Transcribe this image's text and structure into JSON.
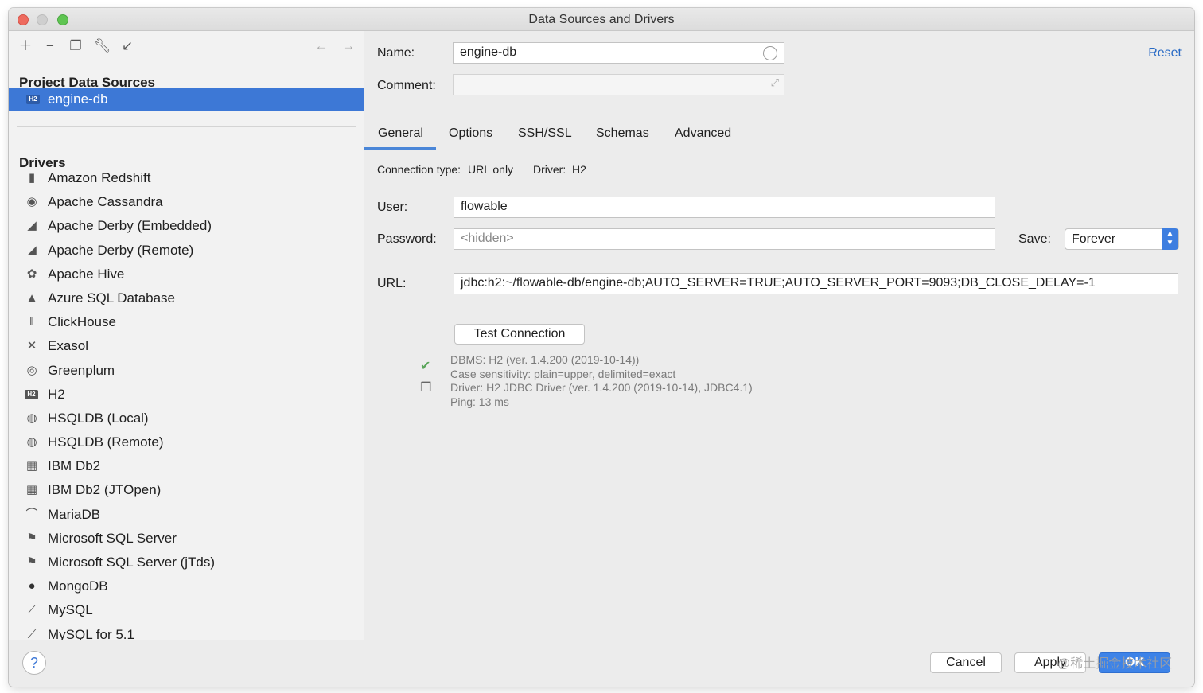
{
  "window": {
    "title": "Data Sources and Drivers"
  },
  "toolbar": {
    "icons": [
      "add-icon",
      "remove-icon",
      "duplicate-icon",
      "wrench-icon",
      "import-icon",
      "back-arrow-icon",
      "forward-arrow-icon"
    ]
  },
  "sidebar": {
    "project_title": "Project Data Sources",
    "selected": {
      "badge": "H2",
      "label": "engine-db"
    },
    "drivers_title": "Drivers",
    "drivers": [
      {
        "label": "Amazon Redshift",
        "icon": "redshift-icon"
      },
      {
        "label": "Apache Cassandra",
        "icon": "cassandra-icon"
      },
      {
        "label": "Apache Derby (Embedded)",
        "icon": "derby-icon"
      },
      {
        "label": "Apache Derby (Remote)",
        "icon": "derby-icon"
      },
      {
        "label": "Apache Hive",
        "icon": "hive-icon"
      },
      {
        "label": "Azure SQL Database",
        "icon": "azure-icon"
      },
      {
        "label": "ClickHouse",
        "icon": "clickhouse-icon"
      },
      {
        "label": "Exasol",
        "icon": "exasol-icon"
      },
      {
        "label": "Greenplum",
        "icon": "greenplum-icon"
      },
      {
        "label": "H2",
        "icon": "h2-icon"
      },
      {
        "label": "HSQLDB (Local)",
        "icon": "hsqldb-icon"
      },
      {
        "label": "HSQLDB (Remote)",
        "icon": "hsqldb-icon"
      },
      {
        "label": "IBM Db2",
        "icon": "db2-icon"
      },
      {
        "label": "IBM Db2 (JTOpen)",
        "icon": "db2-icon"
      },
      {
        "label": "MariaDB",
        "icon": "mariadb-icon"
      },
      {
        "label": "Microsoft SQL Server",
        "icon": "mssql-icon"
      },
      {
        "label": "Microsoft SQL Server (jTds)",
        "icon": "mssql-icon"
      },
      {
        "label": "MongoDB",
        "icon": "mongodb-icon"
      },
      {
        "label": "MySQL",
        "icon": "mysql-icon"
      },
      {
        "label": "MySQL for 5.1",
        "icon": "mysql-icon"
      }
    ]
  },
  "form": {
    "name_label": "Name:",
    "name_value": "engine-db",
    "comment_label": "Comment:",
    "comment_value": "",
    "reset_label": "Reset",
    "tabs": [
      "General",
      "Options",
      "SSH/SSL",
      "Schemas",
      "Advanced"
    ],
    "active_tab": "General",
    "connection_type_label": "Connection type:",
    "connection_type_value": "URL only",
    "driver_label": "Driver:",
    "driver_value": "H2",
    "user_label": "User:",
    "user_value": "flowable",
    "password_label": "Password:",
    "password_placeholder": "<hidden>",
    "save_label": "Save:",
    "save_value": "Forever",
    "url_label": "URL:",
    "url_value": "jdbc:h2:~/flowable-db/engine-db;AUTO_SERVER=TRUE;AUTO_SERVER_PORT=9093;DB_CLOSE_DELAY=-1",
    "test_button": "Test Connection",
    "result_lines": [
      "DBMS: H2 (ver. 1.4.200 (2019-10-14))",
      "Case sensitivity: plain=upper, delimited=exact",
      "Driver: H2 JDBC Driver (ver. 1.4.200 (2019-10-14), JDBC4.1)",
      "Ping: 13 ms"
    ]
  },
  "footer": {
    "help": "?",
    "cancel": "Cancel",
    "apply": "Apply",
    "ok": "OK",
    "watermark": "@稀土掘金技术社区"
  },
  "colors": {
    "accent": "#3d78d6",
    "link": "#2a6bc5",
    "success": "#5aa55a"
  }
}
